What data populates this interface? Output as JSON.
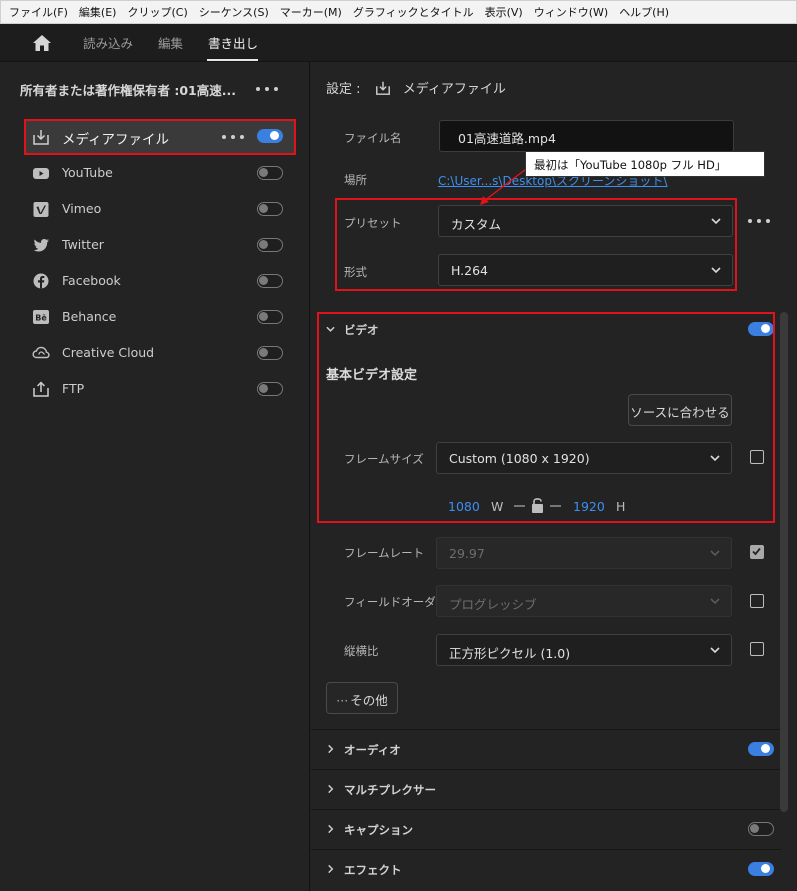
{
  "menu": [
    "ファイル(F)",
    "編集(E)",
    "クリップ(C)",
    "シーケンス(S)",
    "マーカー(M)",
    "グラフィックとタイトル",
    "表示(V)",
    "ウィンドウ(W)",
    "ヘルプ(H)"
  ],
  "nav": {
    "tabs": [
      "読み込み",
      "編集",
      "書き出し"
    ],
    "active": "書き出し"
  },
  "left": {
    "owner": "所有者または著作権保有者 :01高速...",
    "destinations": [
      {
        "label": "メディアファイル",
        "icon": "download-icon",
        "enabled": true,
        "selected": true
      },
      {
        "label": "YouTube",
        "icon": "youtube-icon",
        "enabled": false
      },
      {
        "label": "Vimeo",
        "icon": "vimeo-icon",
        "enabled": false
      },
      {
        "label": "Twitter",
        "icon": "twitter-icon",
        "enabled": false
      },
      {
        "label": "Facebook",
        "icon": "facebook-icon",
        "enabled": false
      },
      {
        "label": "Behance",
        "icon": "behance-icon",
        "enabled": false
      },
      {
        "label": "Creative Cloud",
        "icon": "creative-cloud-icon",
        "enabled": false
      },
      {
        "label": "FTP",
        "icon": "upload-icon",
        "enabled": false
      }
    ]
  },
  "settings": {
    "header_prefix": "設定 :",
    "header_title": "メディアファイル",
    "filename_label": "ファイル名",
    "filename_value": "01高速道路.mp4",
    "location_label": "場所",
    "location_value": "C:\\User...s\\Desktop\\スクリーンショット\\",
    "preset_label": "プリセット",
    "preset_value": "カスタム",
    "format_label": "形式",
    "format_value": "H.264",
    "callout": "最初は「YouTube 1080p フル HD」"
  },
  "video": {
    "section_title": "ビデオ",
    "enabled": true,
    "basic_title": "基本ビデオ設定",
    "match_source": "ソースに合わせる",
    "frame_size_label": "フレームサイズ",
    "frame_size_value": "Custom (1080 x 1920)",
    "width": "1080",
    "width_unit": "W",
    "height": "1920",
    "height_unit": "H",
    "frame_rate_label": "フレームレート",
    "frame_rate_value": "29.97",
    "field_order_label": "フィールドオーダー",
    "field_order_value": "プログレッシブ",
    "aspect_label": "縦横比",
    "aspect_value": "正方形ピクセル (1.0)",
    "more": "その他"
  },
  "sections": [
    {
      "title": "オーディオ",
      "toggle": "on"
    },
    {
      "title": "マルチプレクサー",
      "toggle": "none"
    },
    {
      "title": "キャプション",
      "toggle": "off"
    },
    {
      "title": "エフェクト",
      "toggle": "on"
    }
  ],
  "colors": {
    "accent": "#3b7fe0",
    "highlight": "#e0131b",
    "link": "#3d90ef"
  }
}
